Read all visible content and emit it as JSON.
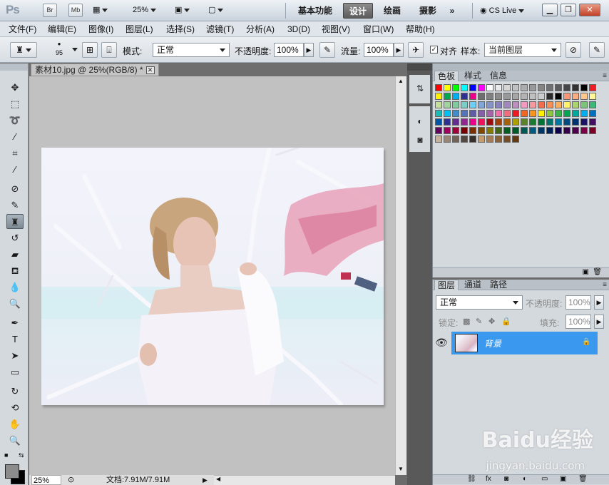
{
  "app": {
    "logo": "Ps",
    "bridge_label": "Br",
    "minibridge_label": "Mb",
    "zoom_value": "25%",
    "workspaces": [
      "基本功能",
      "设计",
      "绘画",
      "摄影"
    ],
    "active_workspace": "设计",
    "more_label": "»",
    "cslive_label": "CS Live"
  },
  "menu": [
    "文件(F)",
    "编辑(E)",
    "图像(I)",
    "图层(L)",
    "选择(S)",
    "滤镜(T)",
    "分析(A)",
    "3D(D)",
    "视图(V)",
    "窗口(W)",
    "帮助(H)"
  ],
  "options": {
    "brush_size": "95",
    "mode_label": "模式:",
    "mode_value": "正常",
    "opacity_label": "不透明度:",
    "opacity_value": "100%",
    "flow_label": "流量:",
    "flow_value": "100%",
    "align_label": "对齐",
    "align_checked": true,
    "sample_label": "样本:",
    "sample_value": "当前图层"
  },
  "document": {
    "tab_title": "素材10.jpg @ 25%(RGB/8) *",
    "status_zoom": "25%",
    "status_doc": "文档:7.91M/7.91M"
  },
  "swatches_panel": {
    "tabs": [
      "色板",
      "样式",
      "信息"
    ],
    "active_tab": "色板"
  },
  "layers_panel": {
    "tabs": [
      "图层",
      "通道",
      "路径"
    ],
    "active_tab": "图层",
    "blend_mode": "正常",
    "opacity_label": "不透明度:",
    "opacity_value": "100%",
    "lock_label": "锁定:",
    "fill_label": "填充:",
    "fill_value": "100%",
    "layers": [
      {
        "name": "背景",
        "visible": true,
        "locked": true,
        "selected": true
      }
    ]
  },
  "colors": {
    "accent_selected_layer": "#3a99ee",
    "active_workspace_bg": "#6d6d6d",
    "close_button": "#c84a30"
  },
  "watermark": {
    "logo_text": "Baidu经验",
    "url": "jingyan.baidu.com"
  }
}
